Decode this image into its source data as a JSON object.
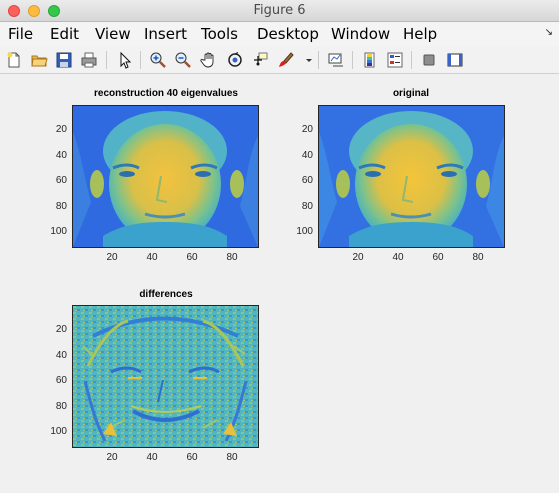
{
  "window": {
    "title": "Figure 6"
  },
  "menu": {
    "items": [
      "File",
      "Edit",
      "View",
      "Insert",
      "Tools",
      "Desktop",
      "Window",
      "Help"
    ]
  },
  "toolbar": {
    "icons": [
      "new-figure-icon",
      "open-icon",
      "save-icon",
      "print-icon",
      "pointer-icon",
      "zoom-in-icon",
      "zoom-out-icon",
      "pan-icon",
      "rotate-icon",
      "data-cursor-icon",
      "brush-icon",
      "link-icon",
      "colorbar-icon",
      "legend-icon",
      "hide-tools-icon",
      "dock-icon"
    ]
  },
  "axes": [
    {
      "title": "reconstruction 40 eigenvalues",
      "xticks": [
        "20",
        "40",
        "60",
        "80"
      ],
      "yticks": [
        "20",
        "40",
        "60",
        "80",
        "100"
      ],
      "image": "face"
    },
    {
      "title": "original",
      "xticks": [
        "20",
        "40",
        "60",
        "80"
      ],
      "yticks": [
        "20",
        "40",
        "60",
        "80",
        "100"
      ],
      "image": "face"
    },
    {
      "title": "differences",
      "xticks": [
        "20",
        "40",
        "60",
        "80"
      ],
      "yticks": [
        "20",
        "40",
        "60",
        "80",
        "100"
      ],
      "image": "diff"
    }
  ],
  "colors": {
    "colormap_low": "#1f3fe0",
    "colormap_mid": "#4bb8c8",
    "colormap_high": "#f5c23c"
  }
}
